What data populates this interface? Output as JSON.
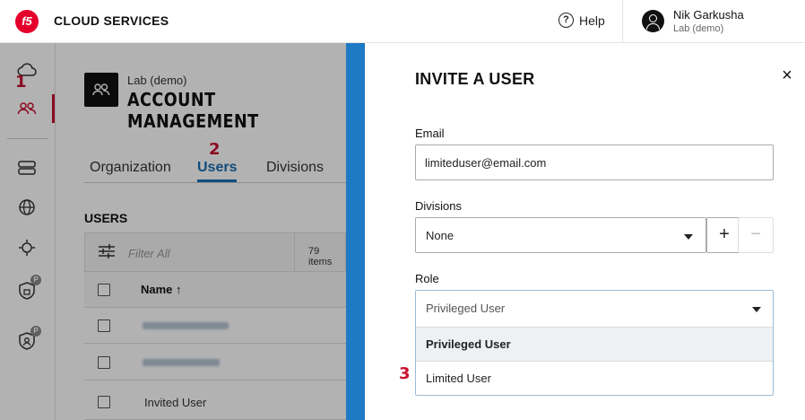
{
  "header": {
    "logo_text": "f5",
    "brand": "CLOUD SERVICES",
    "help_label": "Help",
    "user_name": "Nik Garkusha",
    "user_org": "Lab (demo)"
  },
  "rail": {
    "icons": [
      "cloud-icon",
      "users-icon",
      "servers-icon",
      "globe-icon",
      "bot-defense-icon",
      "lock-shield-icon",
      "person-shield-icon"
    ],
    "badge": "P"
  },
  "annotations": {
    "step1": "1",
    "step2": "2",
    "step3": "3"
  },
  "page": {
    "subtitle": "Lab (demo)",
    "title": "ACCOUNT MANAGEMENT",
    "tabs": [
      {
        "label": "Organization"
      },
      {
        "label": "Users",
        "active": true
      },
      {
        "label": "Divisions"
      }
    ],
    "users_heading": "USERS",
    "filter_placeholder": "Filter All",
    "items_count": "79 items",
    "column_name": "Name ↑",
    "rows": [
      {
        "name": "",
        "redacted": true
      },
      {
        "name": "",
        "redacted": true
      },
      {
        "name": "Invited User"
      }
    ]
  },
  "drawer": {
    "title": "INVITE A USER",
    "close_symbol": "×",
    "email": {
      "label": "Email",
      "value": "limiteduser@email.com"
    },
    "divisions": {
      "label": "Divisions",
      "value": "None",
      "add_symbol": "+",
      "remove_symbol": "−"
    },
    "role": {
      "label": "Role",
      "selected": "Privileged User",
      "options": [
        "Privileged User",
        "Limited User"
      ],
      "highlighted": "Privileged User"
    }
  },
  "colors": {
    "brand_red": "#e4002b",
    "accent_blue": "#1f7ac4",
    "annotation_red": "#c8102e"
  }
}
